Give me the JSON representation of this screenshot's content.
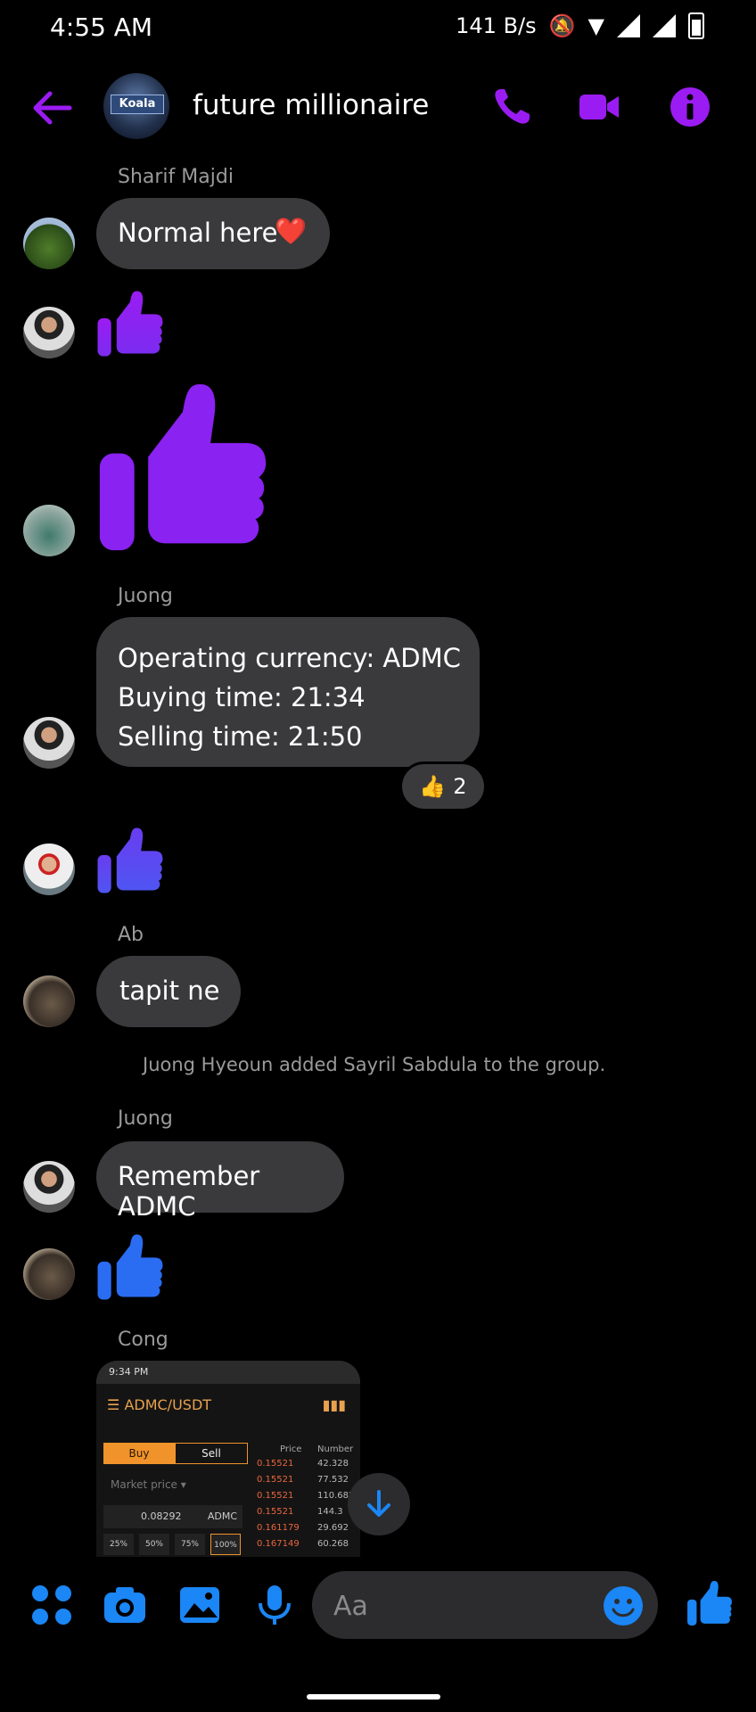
{
  "status_bar": {
    "time": "4:55 AM",
    "network_speed": "141 B/s",
    "sim1": "1",
    "sim2": "2"
  },
  "header": {
    "title": "future millionaire",
    "group_logo_text": "Koala"
  },
  "colors": {
    "accent": "#9b1cf2",
    "blue": "#1b86f5",
    "bubble": "#3a3a3c",
    "background": "#000000"
  },
  "messages": [
    {
      "sender": "Sharif Majdi",
      "text": "Normal here",
      "emoji": "❤️"
    },
    {
      "type": "like",
      "size": "small"
    },
    {
      "type": "like",
      "size": "large"
    },
    {
      "sender": "Juong",
      "lines": [
        "Operating currency: ADMC",
        "Buying time: 21:34",
        "Selling time: 21:50"
      ],
      "reaction": {
        "emoji": "👍",
        "count": "2"
      }
    },
    {
      "type": "like",
      "size": "small"
    },
    {
      "sender": "Ab",
      "text": "tapit ne"
    },
    {
      "system": "Juong Hyeoun added Sayril Sabdula to the group."
    },
    {
      "sender": "Juong",
      "text": "Remember ADMC"
    },
    {
      "type": "like",
      "size": "small"
    },
    {
      "sender": "Cong",
      "image": {
        "status_time": "9:34 PM",
        "pair": "ADMC/USDT",
        "buy": "Buy",
        "sell": "Sell",
        "market_price": "Market price",
        "amount": "0.08292",
        "unit": "ADMC",
        "percents": [
          "25%",
          "50%",
          "75%",
          "100%"
        ],
        "col_price": "Price",
        "col_number": "Number",
        "rows": [
          {
            "price": "0.15521",
            "number": "42.328"
          },
          {
            "price": "0.15521",
            "number": "77.532"
          },
          {
            "price": "0.15521",
            "number": "110.682"
          },
          {
            "price": "0.15521",
            "number": "144.3"
          },
          {
            "price": "0.161179",
            "number": "29.692"
          },
          {
            "price": "0.167149",
            "number": "60.268"
          }
        ]
      }
    }
  ],
  "composer": {
    "placeholder": "Aa"
  }
}
